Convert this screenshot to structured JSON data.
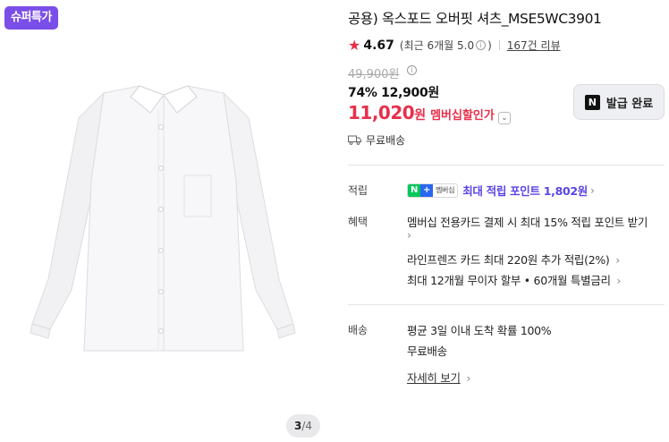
{
  "gallery": {
    "badge": "슈퍼특가",
    "pager_current": "3",
    "pager_total": "/4"
  },
  "product": {
    "title": "공용) 옥스포드 오버핏 셔츠_MSE5WC3901",
    "rating_score": "4.67",
    "rating_recent_prefix": "(최근 6개월 5.0",
    "rating_recent_suffix": ")",
    "review_count": "167건 리뷰",
    "original_price": "49,900원",
    "discount_line": "74% 12,900원",
    "member_price": "11,020",
    "member_won": "원",
    "member_label": "멤버십할인가",
    "coupon_button": "발급 완료",
    "coupon_icon_letter": "N",
    "shipping_top": "무료배송"
  },
  "details": {
    "points_label": "적립",
    "npay_badge_text": "멤버십",
    "points_text": "최대 적립 포인트 1,802원",
    "benefits_label": "혜택",
    "benefit_1": "멤버십 전용카드 결제 시 최대 15% 적립 포인트 받기",
    "benefit_2": "라인프렌즈 카드 최대 220원 추가 적립(2%)",
    "benefit_3": "최대 12개월 무이자 할부 • 60개월 특별금리",
    "delivery_label": "배송",
    "delivery_1": "평균 3일 이내 도착 확률 100%",
    "delivery_2": "무료배송",
    "detail_link": "자세히 보기"
  },
  "colors": {
    "accent_red": "#e8304b",
    "badge_purple": "#7a4ee8",
    "point_purple": "#5a45e6"
  }
}
